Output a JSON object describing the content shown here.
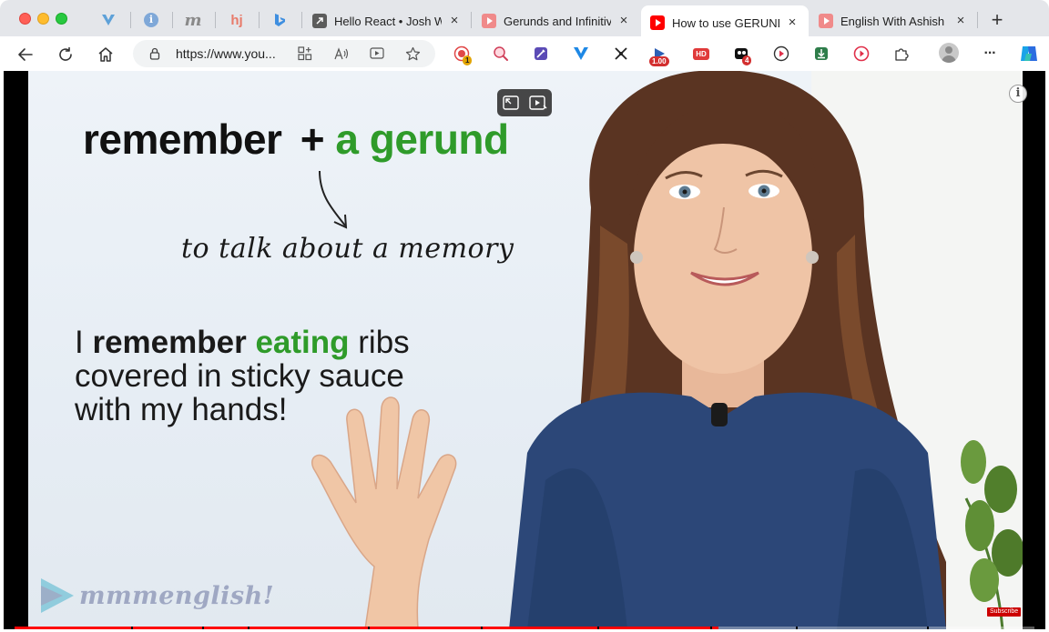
{
  "browser": {
    "tabs": [
      {
        "title": "Hello React • Josh W",
        "favicon": "external-link-icon",
        "active": false
      },
      {
        "title": "Gerunds and Infinitive",
        "favicon": "youtube-icon",
        "active": false
      },
      {
        "title": "How to use GERUNDS",
        "favicon": "youtube-icon",
        "active": true
      },
      {
        "title": "English With Ashish -",
        "favicon": "youtube-icon",
        "active": false
      }
    ],
    "pinned_tabs": [
      "vuetify-icon",
      "info-icon",
      "m-icon",
      "hj-icon",
      "bing-icon"
    ],
    "pinned_glyphs": {
      "m": "m",
      "hj": "hj",
      "info": "i"
    },
    "tab_close_glyph": "×",
    "new_tab_glyph": "+",
    "url": "https://www.you...",
    "extension_badges": {
      "record": "1",
      "speed": "1.00",
      "hd": "HD",
      "counter": "4"
    },
    "menu_glyph": "···"
  },
  "video": {
    "slide": {
      "heading_verb": "remember",
      "heading_plus": "+",
      "heading_object": "a gerund",
      "note": "to talk about a memory",
      "example_start": "I",
      "example_verb": "remember",
      "example_gerund": "eating",
      "example_rest_1": "ribs",
      "example_line_2": "covered in sticky sauce",
      "example_line_3": "with my hands!"
    },
    "brand": "mmmenglish!",
    "subscribe": "Subscribe",
    "info_glyph": "i",
    "progress_fraction": 0.69,
    "accent_color": "#2f9b2a",
    "progress_color": "#ff0000"
  }
}
